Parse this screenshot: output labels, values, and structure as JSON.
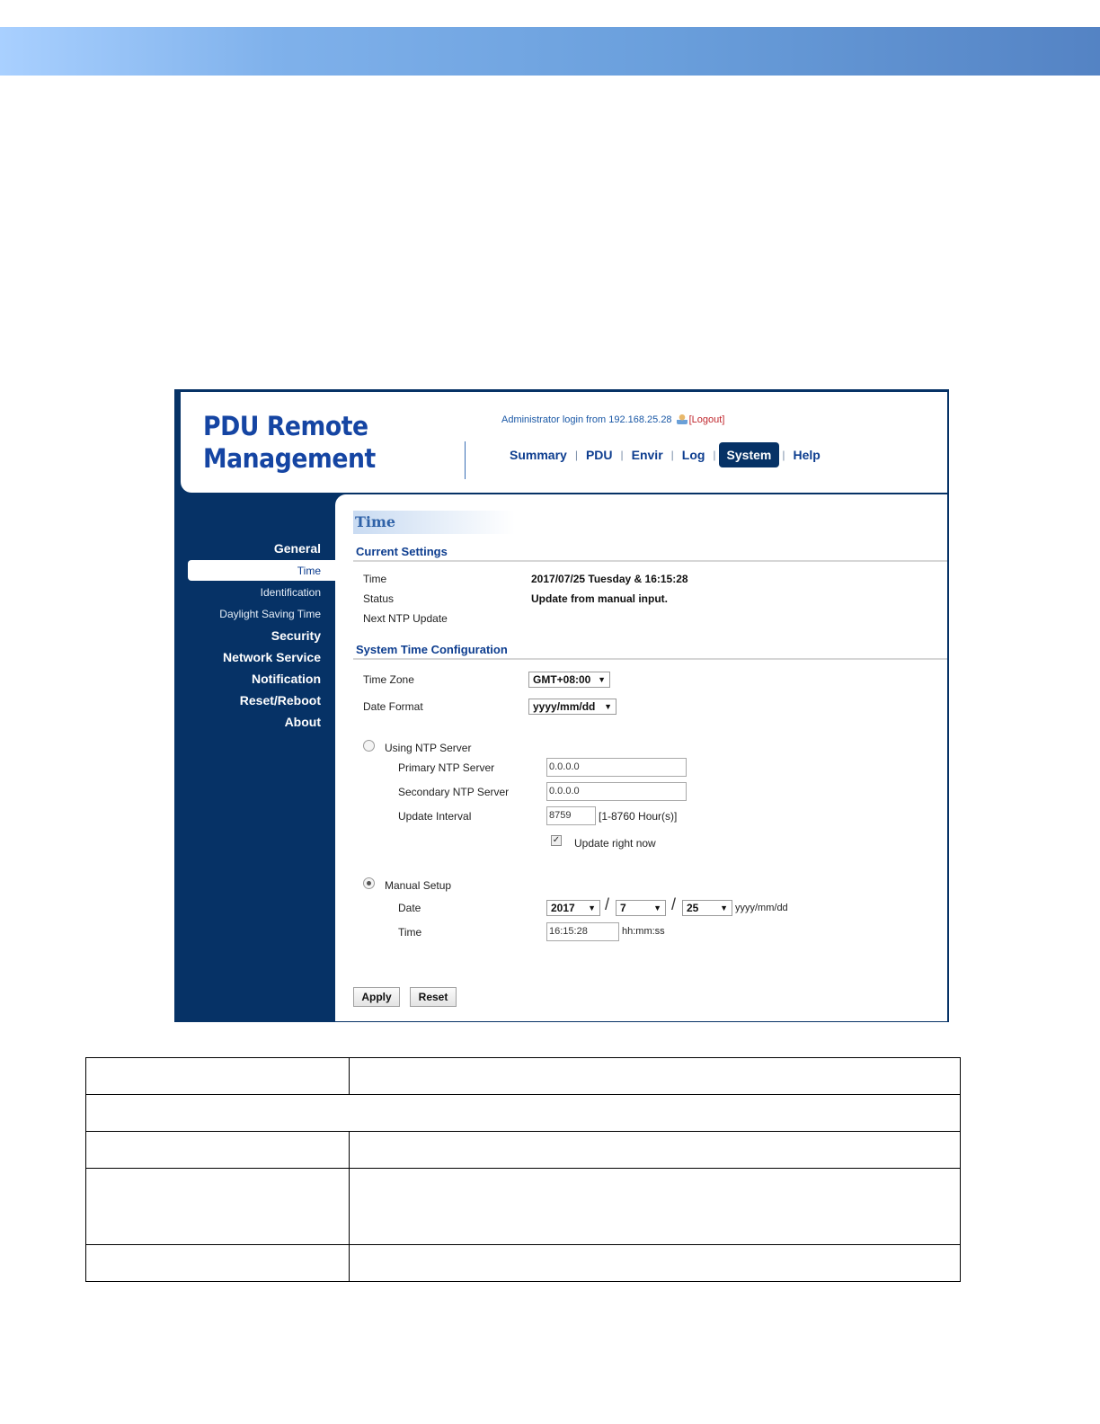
{
  "header": {
    "logo_line1": "PDU Remote",
    "logo_line2": "Management",
    "login_text": "Administrator login from 192.168.25.28",
    "logout_label": "[Logout]"
  },
  "topnav": {
    "items": [
      "Summary",
      "PDU",
      "Envir",
      "Log",
      "System",
      "Help"
    ],
    "active": "System"
  },
  "sidebar": {
    "general": "General",
    "time": "Time",
    "identification": "Identification",
    "dst": "Daylight Saving Time",
    "security": "Security",
    "network_service": "Network Service",
    "notification": "Notification",
    "reset_reboot": "Reset/Reboot",
    "about": "About"
  },
  "content": {
    "page_title": "Time",
    "current_settings": {
      "title": "Current Settings",
      "time_label": "Time",
      "time_value": "2017/07/25 Tuesday & 16:15:28",
      "status_label": "Status",
      "status_value": "Update from manual input.",
      "next_ntp_label": "Next NTP Update",
      "next_ntp_value": ""
    },
    "config": {
      "title": "System Time Configuration",
      "time_zone_label": "Time Zone",
      "time_zone_value": "GMT+08:00",
      "date_format_label": "Date Format",
      "date_format_value": "yyyy/mm/dd",
      "ntp": {
        "label": "Using NTP Server",
        "selected": false,
        "primary_label": "Primary NTP Server",
        "primary_value": "0.0.0.0",
        "secondary_label": "Secondary NTP Server",
        "secondary_value": "0.0.0.0",
        "interval_label": "Update Interval",
        "interval_value": "8759",
        "interval_hint": "[1-8760 Hour(s)]",
        "update_now_label": "Update right now",
        "update_now_checked": true
      },
      "manual": {
        "label": "Manual Setup",
        "selected": true,
        "date_label": "Date",
        "year": "2017",
        "month": "7",
        "day": "25",
        "date_hint": "yyyy/mm/dd",
        "time_label": "Time",
        "time_value": "16:15:28",
        "time_hint": "hh:mm:ss"
      }
    },
    "apply_label": "Apply",
    "reset_label": "Reset"
  },
  "icons": {
    "user": "user-icon",
    "dropdown": "chevron-down-icon"
  },
  "colors": {
    "navy": "#063266",
    "brand_blue": "#1545a3",
    "link_blue": "#0d3d8f",
    "logout_red": "#c0272d"
  }
}
